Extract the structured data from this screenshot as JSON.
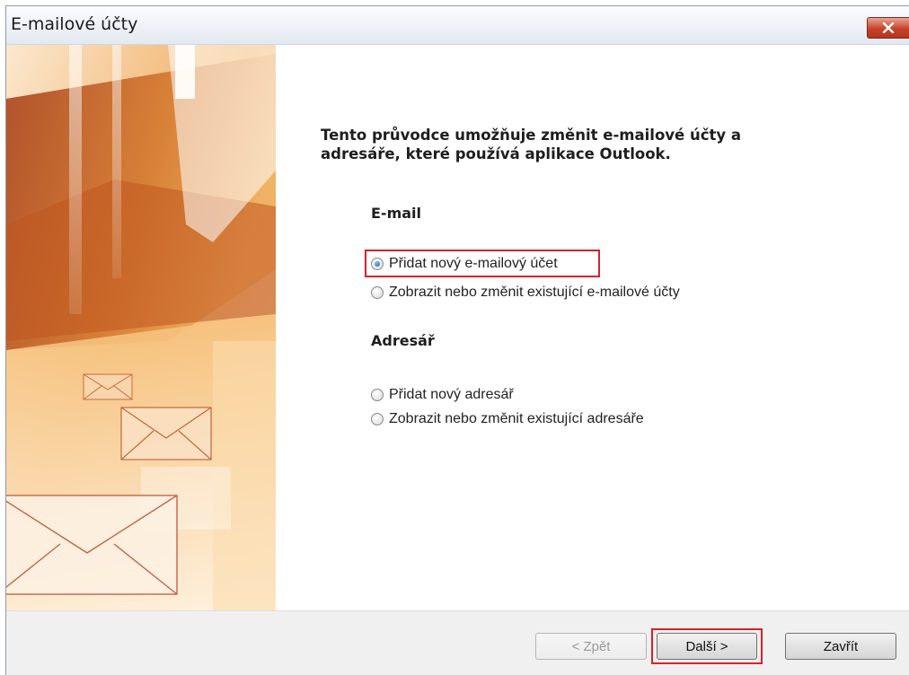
{
  "window": {
    "title": "E-mailové účty"
  },
  "intro": {
    "line1": "Tento průvodce umožňuje změnit e-mailové účty a",
    "line2": "adresáře, které používá aplikace Outlook."
  },
  "email_section": {
    "heading": "E-mail",
    "options": [
      {
        "label": "Přidat nový e-mailový účet",
        "selected": true
      },
      {
        "label": "Zobrazit nebo změnit existující e-mailové účty",
        "selected": false
      }
    ]
  },
  "addressbook_section": {
    "heading": "Adresář",
    "options": [
      {
        "label": "Přidat nový adresář",
        "selected": false
      },
      {
        "label": "Zobrazit nebo změnit existující adresáře",
        "selected": false
      }
    ]
  },
  "footer": {
    "back_label": "< Zpět",
    "next_label": "Další >",
    "close_label": "Zavřít"
  },
  "colors": {
    "highlight": "#d9202a",
    "accent_orange": "#d9823a"
  }
}
